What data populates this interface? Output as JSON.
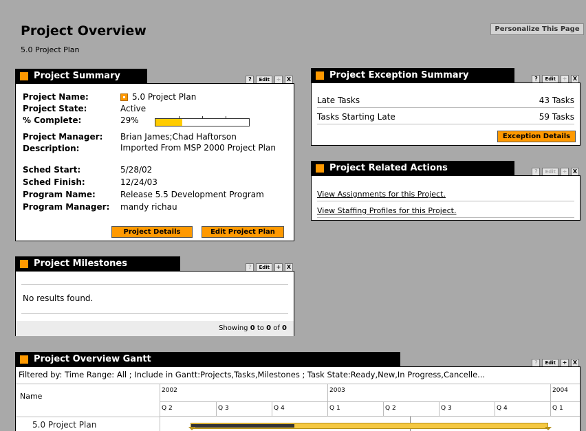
{
  "page": {
    "title": "Project Overview",
    "subtitle": "5.0 Project Plan",
    "personalize_label": "Personalize This Page"
  },
  "controls": {
    "help": "?",
    "edit": "Edit",
    "add": "+",
    "close": "X"
  },
  "summary": {
    "title": "Project Summary",
    "fields": {
      "project_name": {
        "label": "Project Name:",
        "value": "5.0 Project Plan"
      },
      "project_state": {
        "label": "Project State:",
        "value": "Active"
      },
      "complete": {
        "label": "% Complete:",
        "value": "29%",
        "progress": 0.29
      },
      "manager": {
        "label": "Project Manager:",
        "value": "Brian James;Chad Haftorson"
      },
      "description": {
        "label": "Description:",
        "value": "Imported From MSP 2000 Project Plan"
      },
      "sched_start": {
        "label": "Sched Start:",
        "value": "5/28/02"
      },
      "sched_finish": {
        "label": "Sched Finish:",
        "value": "12/24/03"
      },
      "program_name": {
        "label": "Program Name:",
        "value": "Release 5.5 Development Program"
      },
      "program_manager": {
        "label": "Program Manager:",
        "value": "mandy richau"
      }
    },
    "details_btn": "Project Details",
    "edit_plan_btn": "Edit Project Plan"
  },
  "exceptions": {
    "title": "Project Exception Summary",
    "rows": [
      {
        "label": "Late Tasks",
        "value": "43 Tasks"
      },
      {
        "label": "Tasks Starting Late",
        "value": "59 Tasks"
      }
    ],
    "details_btn": "Exception Details"
  },
  "related": {
    "title": "Project Related Actions",
    "links": [
      "View Assignments for this Project.",
      "View Staffing Profiles for this Project."
    ]
  },
  "milestones": {
    "title": "Project Milestones",
    "empty": "No results found.",
    "showing_prefix": "Showing ",
    "from": "0",
    "to_word": " to ",
    "to": "0",
    "of_word": " of ",
    "total": "0"
  },
  "gantt": {
    "title": "Project Overview Gantt",
    "filter": "Filtered by: Time Range: All ; Include in Gantt:Projects,Tasks,Milestones ; Task State:Ready,New,In Progress,Cancelle...",
    "name_header": "Name",
    "years": [
      "2002",
      "2003",
      "2004"
    ],
    "quarters": [
      "Q 2",
      "Q 3",
      "Q 4",
      "Q 1",
      "Q 2",
      "Q 3",
      "Q 4",
      "Q 1"
    ],
    "row_name": "5.0 Project Plan",
    "bar_color": "#f5c842"
  },
  "colors": {
    "accent": "#ff9900",
    "background": "#a9a9a9"
  }
}
